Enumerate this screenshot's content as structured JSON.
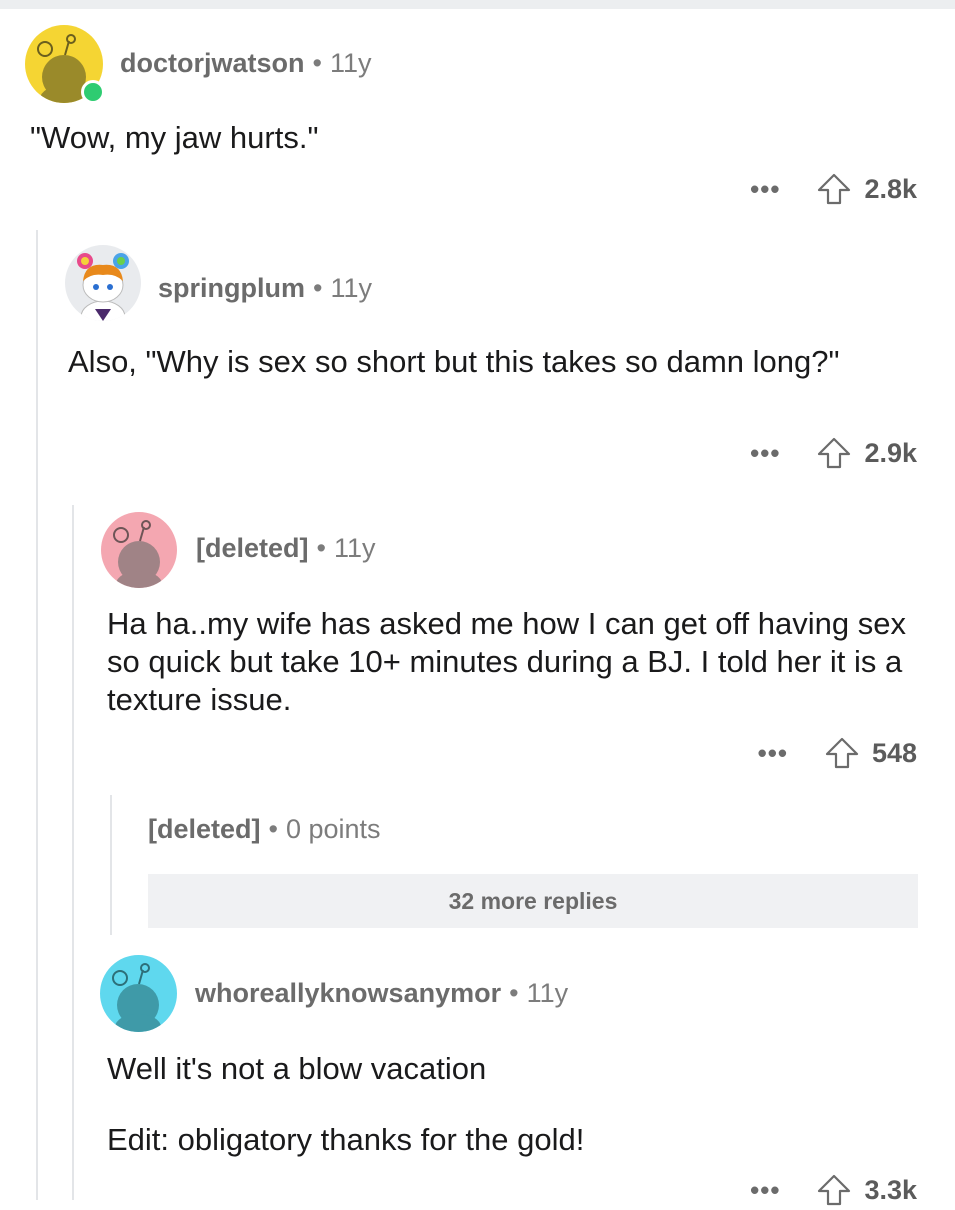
{
  "comments": [
    {
      "username": "doctorjwatson",
      "age": "11y",
      "body": [
        "\"Wow, my jaw hurts.\""
      ],
      "score": "2.8k",
      "avatar_icon": "snoo-avatar-yellow",
      "online": true
    },
    {
      "username": "springplum",
      "age": "11y",
      "body": [
        "Also, \"Why is sex so short but this takes so damn long?\""
      ],
      "score": "2.9k",
      "avatar_icon": "snoo-avatar-custom"
    },
    {
      "username": "[deleted]",
      "age": "11y",
      "body": [
        "Ha ha..my wife has asked me how I can get off having sex so quick but take 10+ minutes during a BJ.  I told her it is a texture issue."
      ],
      "score": "548",
      "avatar_icon": "snoo-avatar-pink"
    },
    {
      "username": "[deleted]",
      "points": "0 points",
      "more_replies": "32 more replies"
    },
    {
      "username": "whoreallyknowsanymor",
      "age": "11y",
      "body": [
        "Well it's not a blow vacation",
        "Edit: obligatory thanks for the gold!"
      ],
      "score": "3.3k",
      "avatar_icon": "snoo-avatar-cyan"
    }
  ],
  "ui": {
    "more_label": "•••",
    "dot": "•"
  },
  "colors": {
    "yellow": "#f5d533",
    "pink": "#f4a7b1",
    "cyan": "#5fd8ee",
    "online": "#2ecc71"
  }
}
